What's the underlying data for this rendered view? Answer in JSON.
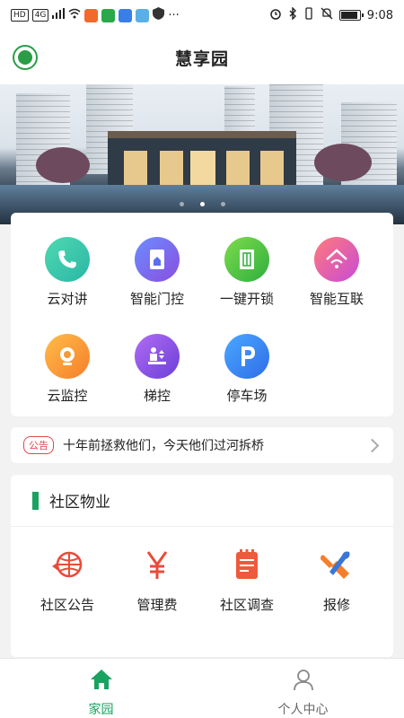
{
  "status_bar": {
    "left_chip_hd": "HD",
    "left_chip_net": "4G",
    "menu_dots": "···",
    "time": "9:08"
  },
  "header": {
    "title": "慧享园"
  },
  "banner": {
    "slide_count": 3,
    "active_slide": 2
  },
  "services": [
    {
      "label": "云对讲",
      "icon": "phone-icon",
      "color": "#3cc9a8"
    },
    {
      "label": "智能门控",
      "icon": "door-control-icon",
      "color": "#4a6cf0"
    },
    {
      "label": "一键开锁",
      "icon": "door-unlock-icon",
      "color": "#47c24d"
    },
    {
      "label": "智能互联",
      "icon": "smart-home-wifi-icon",
      "color": "#e84a8a"
    },
    {
      "label": "云监控",
      "icon": "camera-icon",
      "color": "#f5a03a"
    },
    {
      "label": "梯控",
      "icon": "elevator-icon",
      "color": "#8a4ee0"
    },
    {
      "label": "停车场",
      "icon": "parking-icon",
      "color": "#2f8cf0"
    }
  ],
  "notice": {
    "tag": "公告",
    "text": "十年前拯救他们，今天他们过河拆桥"
  },
  "property": {
    "title": "社区物业",
    "items": [
      {
        "label": "社区公告",
        "icon": "community-notice-icon"
      },
      {
        "label": "管理费",
        "icon": "yen-fee-icon"
      },
      {
        "label": "社区调查",
        "icon": "survey-icon"
      },
      {
        "label": "报修",
        "icon": "repair-tools-icon"
      }
    ]
  },
  "tabbar": {
    "home": "家园",
    "profile": "个人中心"
  },
  "colors": {
    "accent_green": "#1aa260",
    "notice_red": "#e2474a",
    "property_icon_red": "#ea4b3a"
  }
}
